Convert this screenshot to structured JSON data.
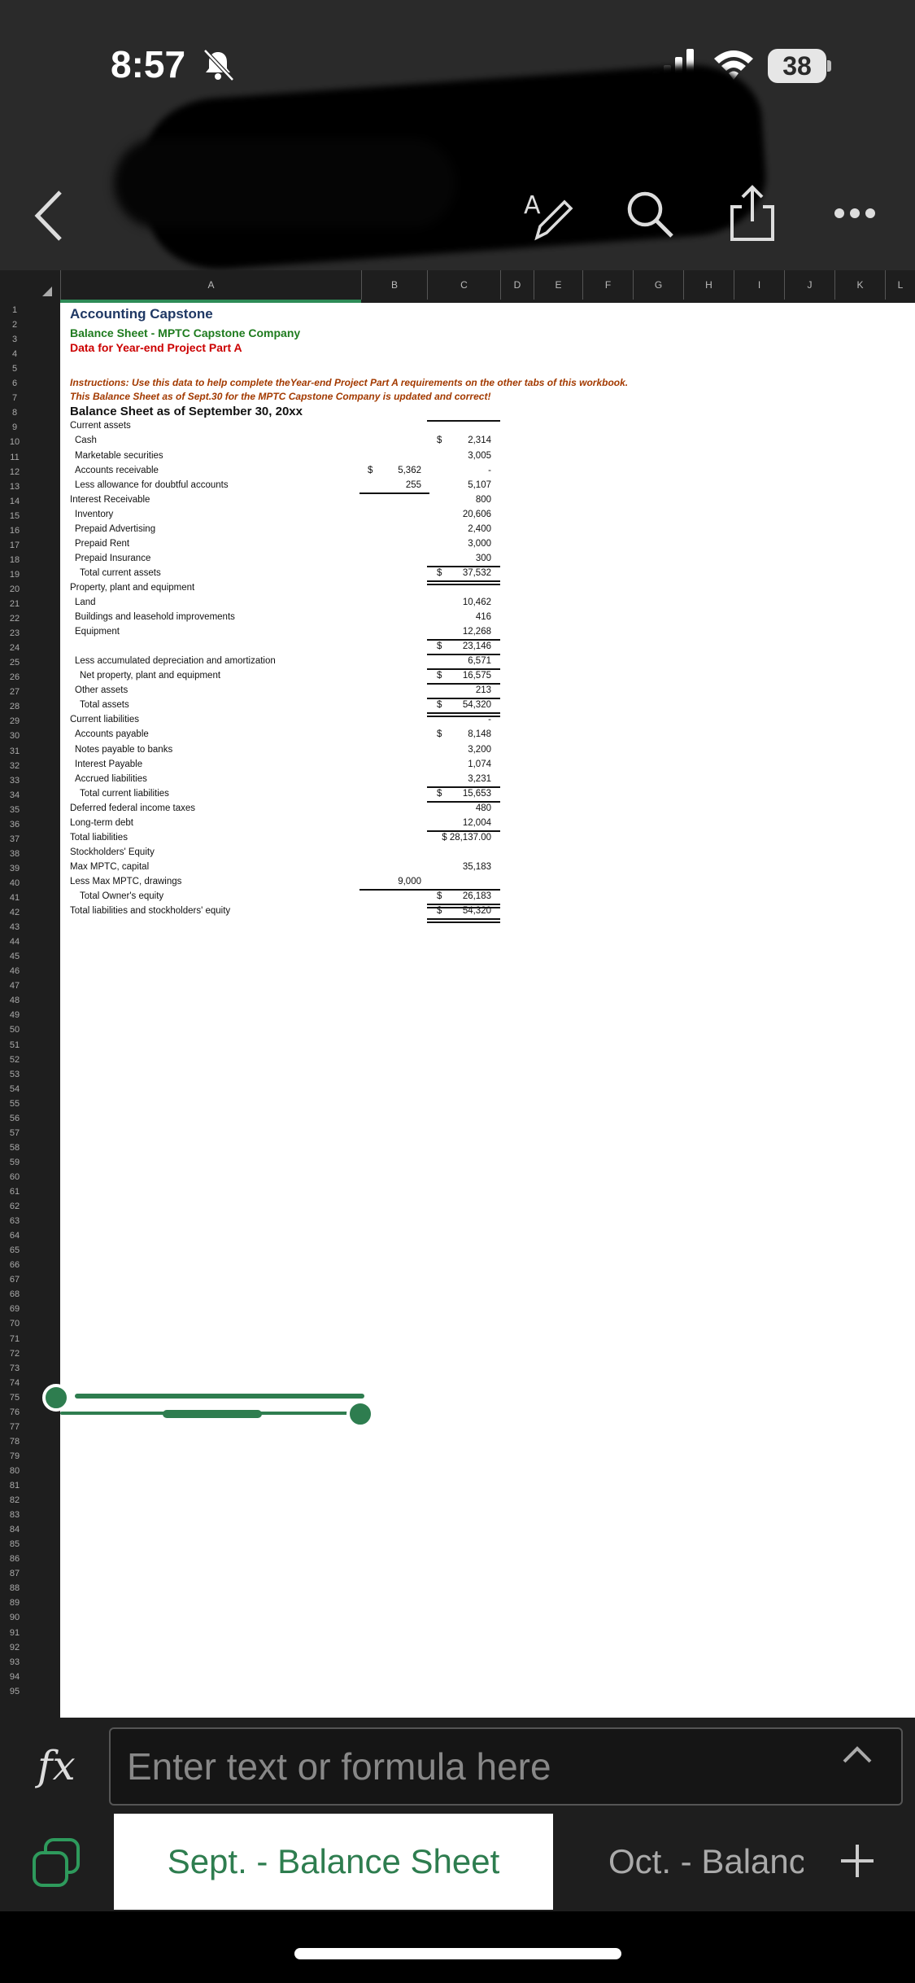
{
  "status_bar": {
    "time": "8:57",
    "battery": "38"
  },
  "columns": [
    "A",
    "B",
    "C",
    "D",
    "E",
    "F",
    "G",
    "H",
    "I",
    "J",
    "K",
    "L"
  ],
  "titles": {
    "line1": "Accounting Capstone",
    "line2": "Balance Sheet - MPTC Capstone Company",
    "line3": "Data for Year-end Project Part A",
    "instr1": "Instructions:  Use this data to help complete theYear-end Project Part A requirements on the other tabs of this workbook.",
    "instr2": "This Balance Sheet as of Sept.30 for the MPTC Capstone Company is updated and correct!",
    "line7": "Balance Sheet as of September 30, 20xx"
  },
  "rows": [
    {
      "label": "Current assets",
      "b": "",
      "c": ""
    },
    {
      "label": "Cash",
      "b": "",
      "c": "2,314",
      "c_dollar": "$"
    },
    {
      "label": "Marketable securities",
      "b": "",
      "c": "3,005"
    },
    {
      "label": "Accounts receivable",
      "b": "5,362",
      "b_dollar": "$",
      "c": "-"
    },
    {
      "label": "Less allowance for doubtful accounts",
      "b": "255",
      "c": "5,107"
    },
    {
      "label": "Interest Receivable",
      "b": "",
      "c": "800"
    },
    {
      "label": "Inventory",
      "b": "",
      "c": "20,606"
    },
    {
      "label": "Prepaid Advertising",
      "b": "",
      "c": "2,400"
    },
    {
      "label": "Prepaid Rent",
      "b": "",
      "c": "3,000"
    },
    {
      "label": "Prepaid Insurance",
      "b": "",
      "c": "300"
    },
    {
      "label": "Total current assets",
      "b": "",
      "c": "37,532",
      "c_dollar": "$"
    },
    {
      "label": "Property, plant and equipment",
      "b": "",
      "c": ""
    },
    {
      "label": "Land",
      "b": "",
      "c": "10,462"
    },
    {
      "label": "Buildings and leasehold improvements",
      "b": "",
      "c": "416"
    },
    {
      "label": "Equipment",
      "b": "",
      "c": "12,268"
    },
    {
      "label": "",
      "b": "",
      "c": "23,146",
      "c_dollar": "$"
    },
    {
      "label": "Less accumulated depreciation and amortization",
      "b": "",
      "c": "6,571"
    },
    {
      "label": "Net property, plant and equipment",
      "b": "",
      "c": "16,575",
      "c_dollar": "$"
    },
    {
      "label": "Other assets",
      "b": "",
      "c": "213"
    },
    {
      "label": "Total assets",
      "b": "",
      "c": "54,320",
      "c_dollar": "$"
    },
    {
      "label": "Current liabilities",
      "b": "",
      "c": "-"
    },
    {
      "label": "Accounts payable",
      "b": "",
      "c": "8,148",
      "c_dollar": "$"
    },
    {
      "label": "Notes payable to banks",
      "b": "",
      "c": "3,200"
    },
    {
      "label": "Interest Payable",
      "b": "",
      "c": "1,074"
    },
    {
      "label": "Accrued liabilities",
      "b": "",
      "c": "3,231"
    },
    {
      "label": "Total current liabilities",
      "b": "",
      "c": "15,653",
      "c_dollar": "$"
    },
    {
      "label": "Deferred federal income taxes",
      "b": "",
      "c": "480"
    },
    {
      "label": "Long-term debt",
      "b": "",
      "c": "12,004"
    },
    {
      "label": "Total liabilities",
      "b": "",
      "c": "$ 28,137.00"
    },
    {
      "label": "Stockholders' Equity",
      "b": "",
      "c": ""
    },
    {
      "label": "Max MPTC, capital",
      "b": "",
      "c": "35,183"
    },
    {
      "label": "Less  Max MPTC, drawings",
      "b": "9,000",
      "c": ""
    },
    {
      "label": "Total Owner's equity",
      "b": "",
      "c": "26,183",
      "c_dollar": "$"
    },
    {
      "label": "Total liabilities and stockholders' equity",
      "b": "",
      "c": "54,320",
      "c_dollar": "$"
    }
  ],
  "formula_bar": {
    "placeholder": "Enter text or formula here"
  },
  "tabs": {
    "active": "Sept. - Balance Sheet",
    "other": "Oct. - Balanc"
  },
  "colors": {
    "accent": "#2e7d4f",
    "title_navy": "#1f3864",
    "title_green": "#1e7b1e",
    "title_red": "#cc0000",
    "instr": "#a33a00"
  }
}
